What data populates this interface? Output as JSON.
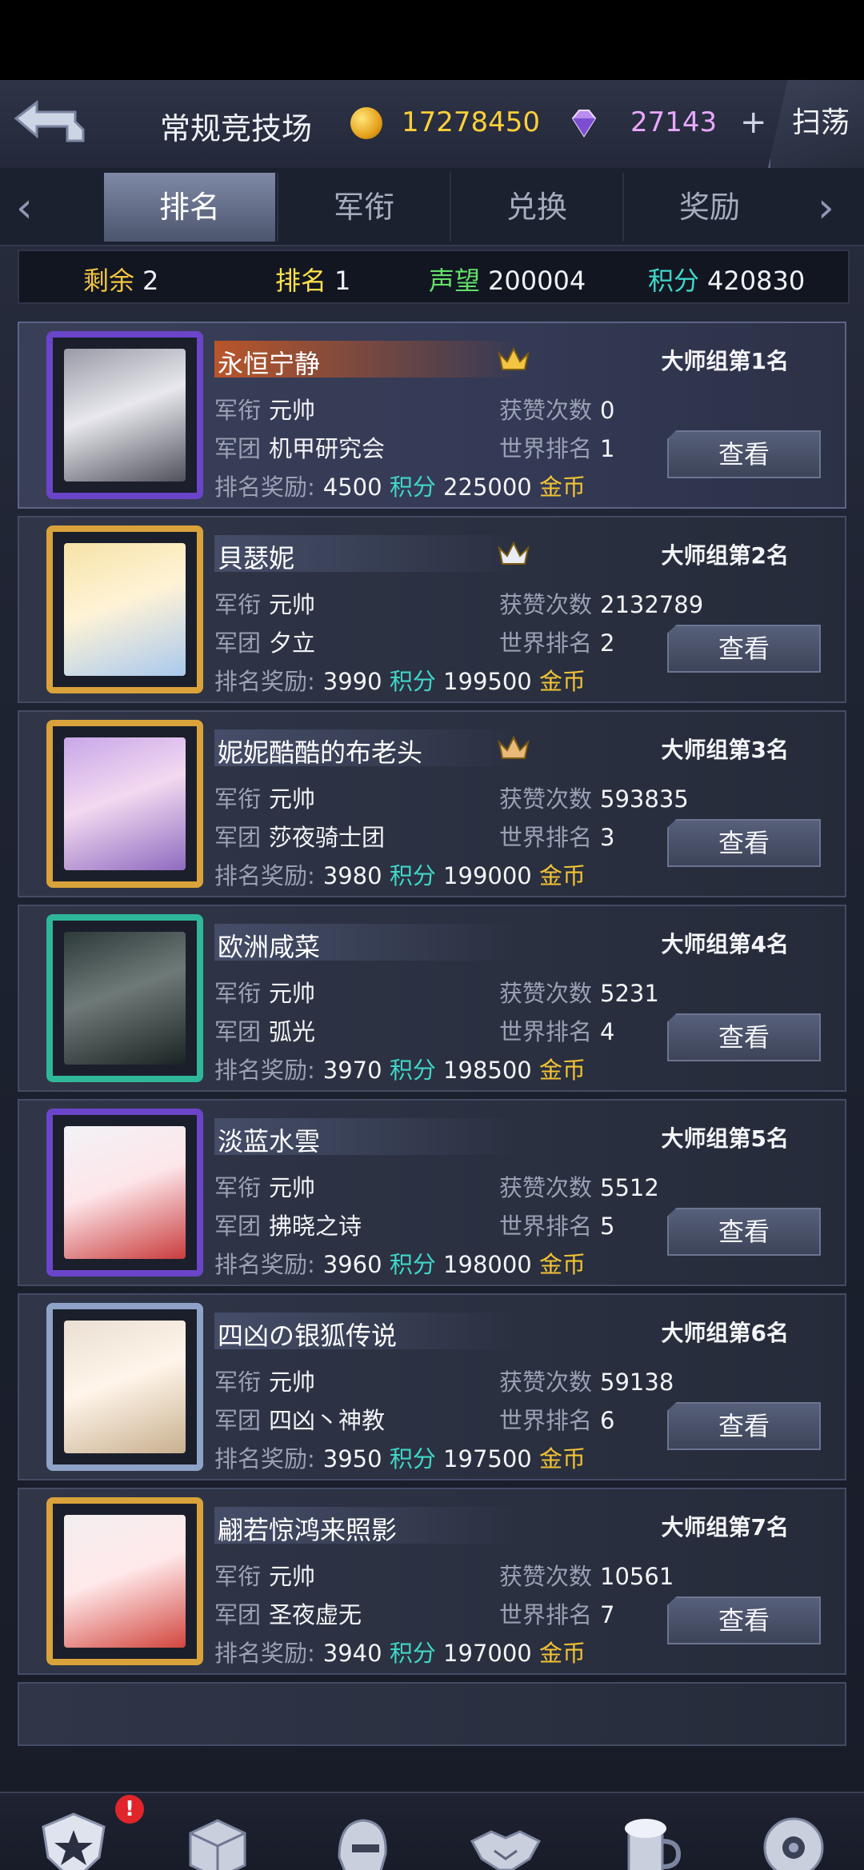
{
  "header": {
    "title": "常规竞技场",
    "gold": "17278450",
    "gems": "27143",
    "plus": "+",
    "sweep_label": "扫荡"
  },
  "tabs": [
    {
      "label": "排名",
      "active": true
    },
    {
      "label": "军衔",
      "active": false
    },
    {
      "label": "兑换",
      "active": false
    },
    {
      "label": "奖励",
      "active": false
    }
  ],
  "stats": {
    "remaining_label": "剩余",
    "remaining": "2",
    "rank_label": "排名",
    "rank": "1",
    "prestige_label": "声望",
    "prestige": "200004",
    "points_label": "积分",
    "points": "420830"
  },
  "labels": {
    "rank_title": "军衔",
    "likes": "获赞次数",
    "legion": "军团",
    "world_rank": "世界排名",
    "reward": "排名奖励:",
    "points_unit": "积分",
    "gold_unit": "金币",
    "view": "查看"
  },
  "players": [
    {
      "name": "永恒宁静",
      "group": "大师组第1名",
      "title": "元帅",
      "likes": "0",
      "legion": "机甲研究会",
      "world_rank": "1",
      "reward_points": "4500",
      "reward_gold": "225000",
      "crown": "1"
    },
    {
      "name": "貝瑟妮",
      "group": "大师组第2名",
      "title": "元帅",
      "likes": "2132789",
      "legion": "夕立",
      "world_rank": "2",
      "reward_points": "3990",
      "reward_gold": "199500",
      "crown": "2"
    },
    {
      "name": "妮妮酷酷的布老头",
      "group": "大师组第3名",
      "title": "元帅",
      "likes": "593835",
      "legion": "莎夜骑士团",
      "world_rank": "3",
      "reward_points": "3980",
      "reward_gold": "199000",
      "crown": "3"
    },
    {
      "name": "欧洲咸菜",
      "group": "大师组第4名",
      "title": "元帅",
      "likes": "5231",
      "legion": "弧光",
      "world_rank": "4",
      "reward_points": "3970",
      "reward_gold": "198500",
      "crown": ""
    },
    {
      "name": "淡蓝水雲",
      "group": "大师组第5名",
      "title": "元帅",
      "likes": "5512",
      "legion": "拂晓之诗",
      "world_rank": "5",
      "reward_points": "3960",
      "reward_gold": "198000",
      "crown": ""
    },
    {
      "name": "四凶の银狐传说",
      "group": "大师组第6名",
      "title": "元帅",
      "likes": "59138",
      "legion": "四凶丶神教",
      "world_rank": "6",
      "reward_points": "3950",
      "reward_gold": "197500",
      "crown": ""
    },
    {
      "name": "翩若惊鸿来照影",
      "group": "大师组第7名",
      "title": "元帅",
      "likes": "10561",
      "legion": "圣夜虚无",
      "world_rank": "7",
      "reward_points": "3940",
      "reward_gold": "197000",
      "crown": ""
    }
  ],
  "nav": [
    {
      "label": "基地",
      "icon": "base-shield-icon",
      "badge": "!"
    },
    {
      "label": "仓库",
      "icon": "warehouse-crate-icon"
    },
    {
      "label": "编队",
      "icon": "formation-helmet-icon"
    },
    {
      "label": "社交",
      "icon": "handshake-icon"
    },
    {
      "label": "酒馆",
      "icon": "beer-mug-icon"
    },
    {
      "label": "商城",
      "icon": "shop-orb-icon"
    }
  ],
  "colors": {
    "points": "#3fd7c9",
    "gold": "#f2c335",
    "remaining_key": "#f4c542",
    "rank_key": "#ffe14d",
    "prestige_key": "#63e06a",
    "points_key": "#3fd7c9"
  }
}
